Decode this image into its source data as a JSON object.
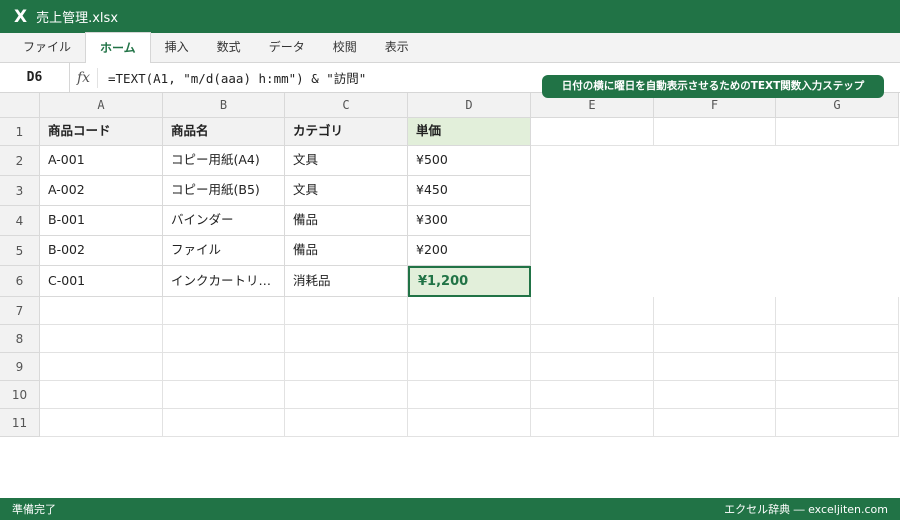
{
  "window": {
    "logo": "X",
    "filename": "売上管理.xlsx"
  },
  "ribbon": {
    "tabs": [
      "ファイル",
      "ホーム",
      "挿入",
      "数式",
      "データ",
      "校閲",
      "表示"
    ],
    "active": "ホーム"
  },
  "formula_bar": {
    "name_box": "D6",
    "fx_label": "fx",
    "formula": "=TEXT(A1, \"m/d(aaa) h:mm\") & \"訪問\""
  },
  "tip_badge": "日付の横に曜日を自動表示させるためのTEXT関数入力ステップ",
  "sheet": {
    "columns": [
      "A",
      "B",
      "C",
      "D",
      "E",
      "F",
      "G"
    ],
    "rows": [
      "1",
      "2",
      "3",
      "4",
      "5",
      "6",
      "7",
      "8",
      "9",
      "10",
      "11"
    ],
    "header": [
      "商品コード",
      "商品名",
      "カテゴリ",
      "単価"
    ],
    "data": [
      [
        "A-001",
        "コピー用紙(A4)",
        "文具",
        "¥500"
      ],
      [
        "A-002",
        "コピー用紙(B5)",
        "文具",
        "¥450"
      ],
      [
        "B-001",
        "バインダー",
        "備品",
        "¥300"
      ],
      [
        "B-002",
        "ファイル",
        "備品",
        "¥200"
      ],
      [
        "C-001",
        "インクカートリ…",
        "消耗品",
        "¥1,200"
      ]
    ],
    "active_cell": "D6"
  },
  "status_bar": {
    "left": "準備完了",
    "right": "エクセル辞典 ― exceljiten.com"
  },
  "colors": {
    "brand": "#217346",
    "accent_fill": "#e2efda",
    "header_fill": "#f2f2f2"
  }
}
